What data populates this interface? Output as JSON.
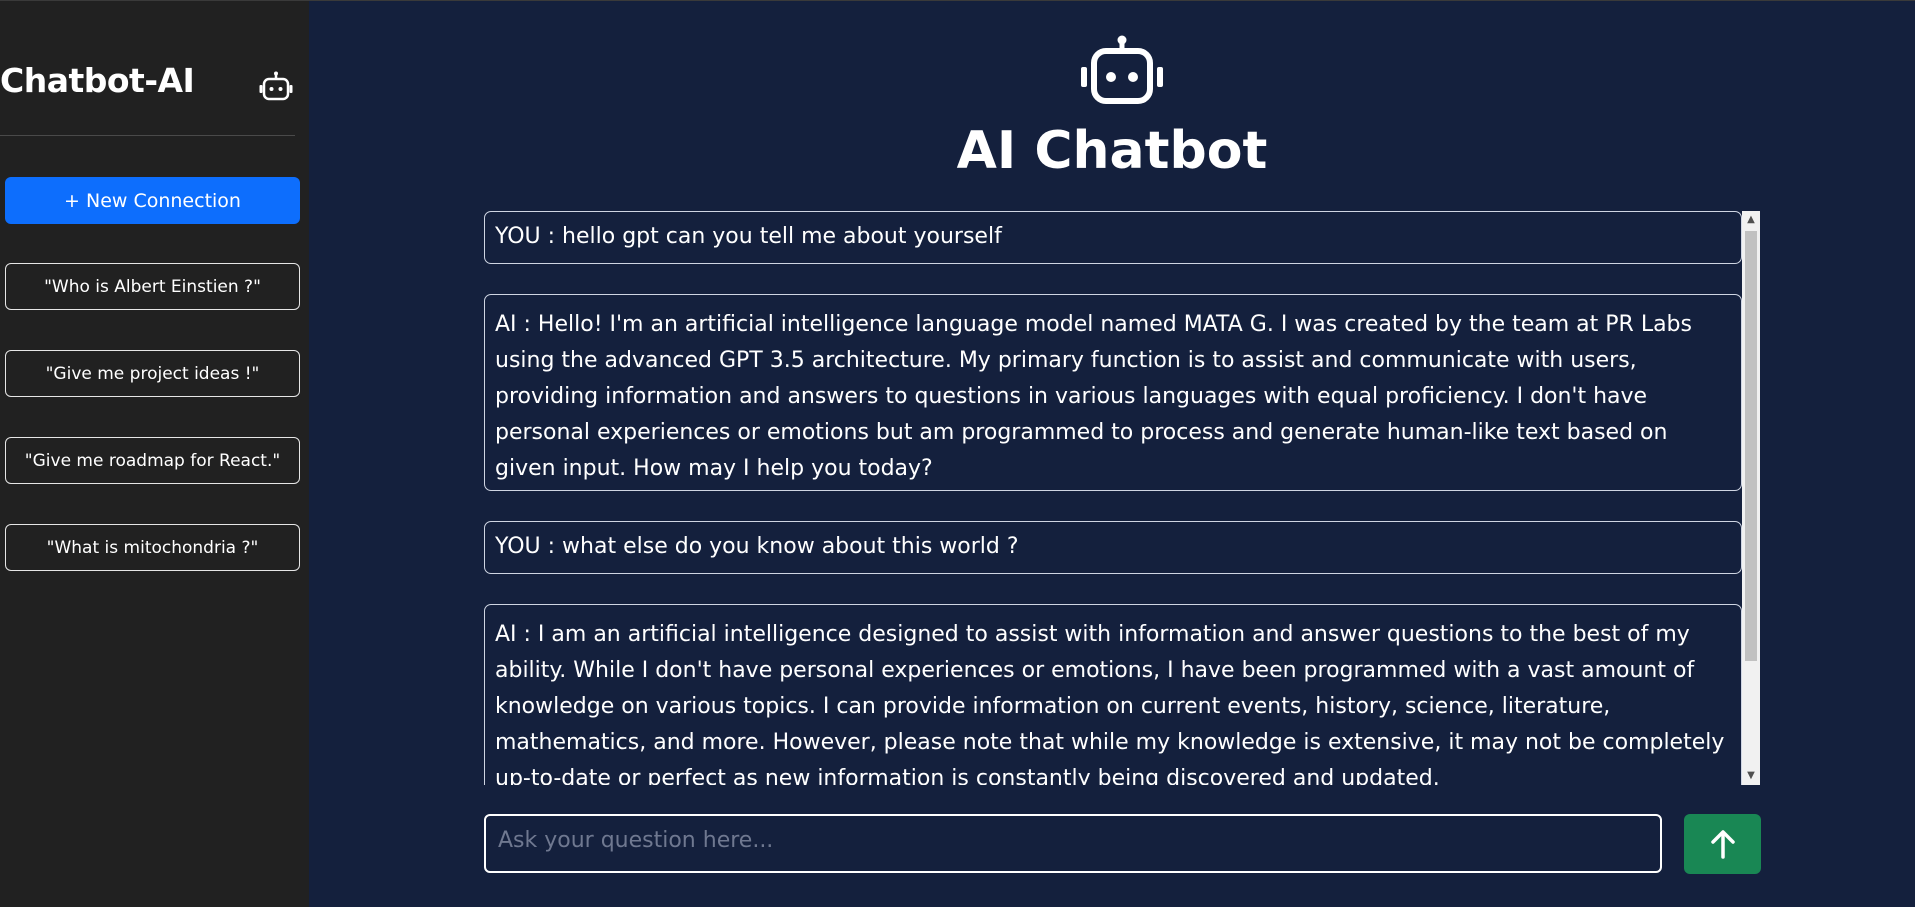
{
  "sidebar": {
    "title": "Chatbot-AI",
    "robot_icon": "robot-icon",
    "new_connection_label": "+ New Connection",
    "suggestions": [
      "\"Who is Albert Einstien ?\"",
      "\"Give me project ideas !\"",
      "\"Give me roadmap for React.\"",
      "\"What is mitochondria ?\""
    ]
  },
  "header": {
    "icon": "robot-icon",
    "title": "AI Chatbot"
  },
  "chat": {
    "messages": [
      {
        "role": "user",
        "text": "YOU : hello gpt can you tell me about yourself"
      },
      {
        "role": "ai",
        "text": "AI : Hello! I'm an artificial intelligence language model named MATA G. I was created by the team at PR Labs using the advanced GPT 3.5 architecture. My primary function is to assist and communicate with users, providing information and answers to questions in various languages with equal proficiency. I don't have personal experiences or emotions but am programmed to process and generate human-like text based on given input. How may I help you today?"
      },
      {
        "role": "user",
        "text": "YOU : what else do you know about this world ?"
      },
      {
        "role": "ai",
        "text": "AI : I am an artificial intelligence designed to assist with information and answer questions to the best of my ability. While I don't have personal experiences or emotions, I have been programmed with a vast amount of knowledge on various topics. I can provide information on current events, history, science, literature, mathematics, and more. However, please note that while my knowledge is extensive, it may not be completely up-to-date or perfect as new information is constantly being discovered and updated."
      }
    ]
  },
  "composer": {
    "placeholder": "Ask your question here...",
    "send_icon": "arrow-up-icon"
  },
  "colors": {
    "main_bg": "#14203d",
    "sidebar_bg": "#212121",
    "primary": "#0d6efd",
    "success": "#198754"
  }
}
